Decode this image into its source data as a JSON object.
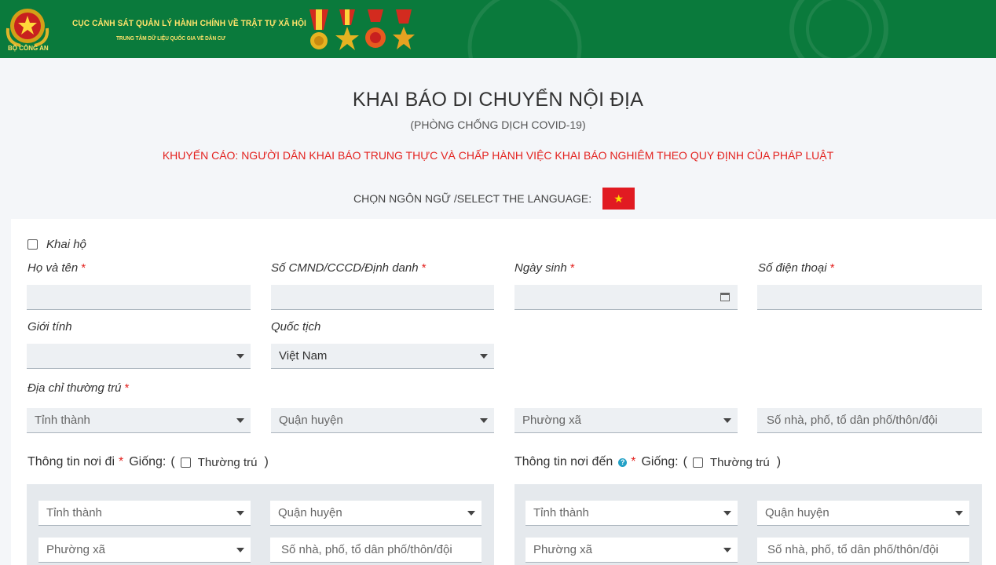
{
  "header": {
    "emblem_text": "BỘ CÔNG AN",
    "org_title": "CỤC CẢNH SÁT QUẢN LÝ HÀNH CHÍNH VỀ TRẬT TỰ XÃ HỘI",
    "org_subtitle": "TRUNG TÂM DỮ LIỆU QUỐC GIA VỀ DÂN CƯ",
    "background_color": "#0a7a3c",
    "text_color": "#ffe36b"
  },
  "page": {
    "title": "KHAI BÁO DI CHUYỂN NỘI ĐỊA",
    "subtitle": "(PHÒNG CHỐNG DỊCH COVID-19)",
    "warning": "KHUYẾN CÁO: NGƯỜI DÂN KHAI BÁO TRUNG THỰC VÀ CHẤP HÀNH VIỆC KHAI BÁO NGHIÊM THEO QUY ĐỊNH CỦA PHÁP LUẬT",
    "warning_color": "#e3221f",
    "language_label": "CHỌN NGÔN NGỮ /SELECT THE LANGUAGE:",
    "language_flag": "vietnam-flag-icon"
  },
  "form": {
    "khai_ho": {
      "label": "Khai hộ",
      "checked": false
    },
    "ho_ten": {
      "label": "Họ và tên",
      "required": "*",
      "value": ""
    },
    "cmnd": {
      "label": "Số CMND/CCCD/Định danh",
      "required": "*",
      "value": ""
    },
    "ngay_sinh": {
      "label": "Ngày sinh",
      "required": "*",
      "value": ""
    },
    "so_dien_thoai": {
      "label": "Số điện thoại",
      "required": "*",
      "value": ""
    },
    "gioi_tinh": {
      "label": "Giới tính",
      "value": ""
    },
    "quoc_tich": {
      "label": "Quốc tịch",
      "value": "Việt Nam"
    },
    "dia_chi": {
      "label": "Địa chỉ thường trú",
      "required": "*",
      "tinh": "Tỉnh thành",
      "quan": "Quận huyện",
      "phuong": "Phường xã",
      "so_nha": "Số nhà, phố, tổ dân phố/thôn/đội"
    },
    "noi_di": {
      "title": "Thông tin nơi đi",
      "required": "*",
      "giong": "Giống:",
      "open": "(",
      "close": ")",
      "thuong_tru": "Thường trú",
      "tinh": "Tỉnh thành",
      "quan": "Quận huyện",
      "phuong": "Phường xã",
      "so_nha": "Số nhà, phố, tổ dân phố/thôn/đội"
    },
    "noi_den": {
      "title": "Thông tin nơi đến",
      "required": "*",
      "giong": "Giống:",
      "open": "(",
      "close": ")",
      "thuong_tru": "Thường trú",
      "tinh": "Tỉnh thành",
      "quan": "Quận huyện",
      "phuong": "Phường xã",
      "so_nha": "Số nhà, phố, tổ dân phố/thôn/đội"
    }
  }
}
